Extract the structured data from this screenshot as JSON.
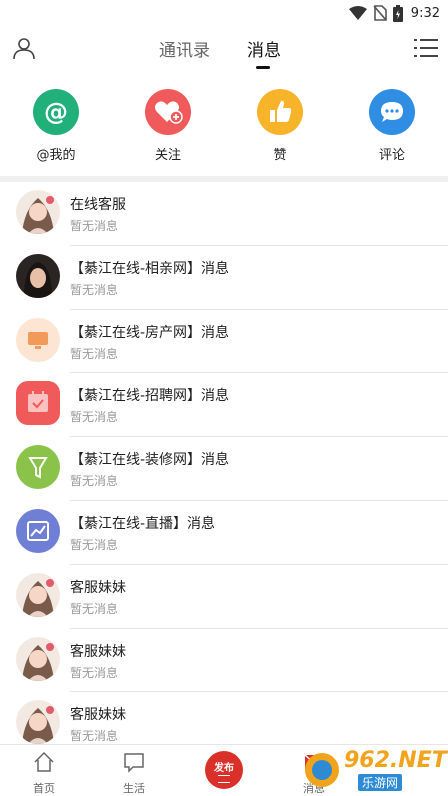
{
  "status_bar": {
    "time": "9:32",
    "icons": [
      "wifi-icon",
      "no-sim-icon",
      "battery-icon"
    ]
  },
  "header": {
    "tabs": [
      {
        "label": "通讯录",
        "active": false
      },
      {
        "label": "消息",
        "active": true
      }
    ],
    "left_icon": "user-icon",
    "right_icon": "menu-icon"
  },
  "quick_actions": [
    {
      "label": "@我的",
      "icon": "at-icon",
      "color": "#21b07a"
    },
    {
      "label": "关注",
      "icon": "heart-plus-icon",
      "color": "#f05a5a"
    },
    {
      "label": "赞",
      "icon": "thumbs-up-icon",
      "color": "#f7b329"
    },
    {
      "label": "评论",
      "icon": "comment-icon",
      "color": "#2f8de4"
    }
  ],
  "messages": [
    {
      "title": "在线客服",
      "subtitle": "暂无消息",
      "avatar": "portrait"
    },
    {
      "title": "【綦江在线-相亲网】消息",
      "subtitle": "暂无消息",
      "avatar": "portrait-dark"
    },
    {
      "title": "【綦江在线-房产网】消息",
      "subtitle": "暂无消息",
      "avatar": "monitor-icon",
      "color": "#f29a59"
    },
    {
      "title": "【綦江在线-招聘网】消息",
      "subtitle": "暂无消息",
      "avatar": "calendar-check-icon",
      "color": "#f05a5a"
    },
    {
      "title": "【綦江在线-装修网】消息",
      "subtitle": "暂无消息",
      "avatar": "funnel-icon",
      "color": "#8bc34a"
    },
    {
      "title": "【綦江在线-直播】消息",
      "subtitle": "暂无消息",
      "avatar": "chart-icon",
      "color": "#6f7fd6"
    },
    {
      "title": "客服妹妹",
      "subtitle": "暂无消息",
      "avatar": "portrait"
    },
    {
      "title": "客服妹妹",
      "subtitle": "暂无消息",
      "avatar": "portrait"
    },
    {
      "title": "客服妹妹",
      "subtitle": "暂无消息",
      "avatar": "portrait"
    }
  ],
  "bottom_nav": {
    "home": "首页",
    "life": "生活",
    "publish": "发布",
    "messages": "消息"
  },
  "watermark": {
    "text": "962.NET",
    "sub": "乐游网"
  }
}
